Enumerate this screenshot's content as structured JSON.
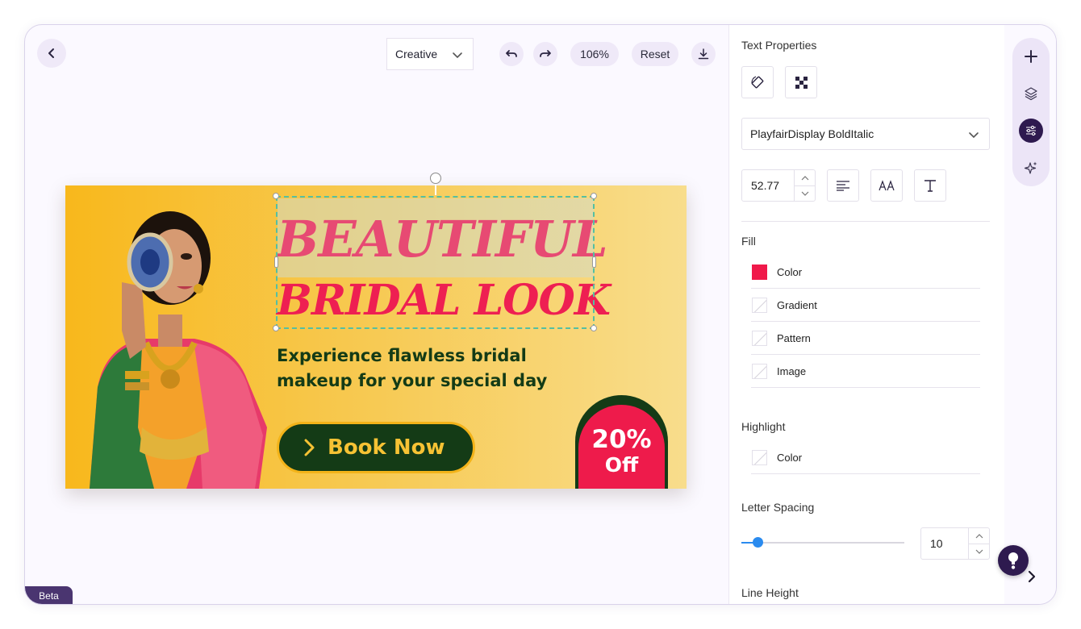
{
  "toolbar": {
    "back_label": "",
    "template_select": "Creative",
    "zoom": "106%",
    "reset_label": "Reset"
  },
  "banner": {
    "headline_line1": "BEAUTIFUL",
    "headline_line2": "BRIDAL LOOK",
    "subline_line1": "Experience flawless bridal",
    "subline_line2": "makeup for your special day",
    "cta_label": "Book Now",
    "offer_percent": "20%",
    "offer_off": "Off",
    "colors": {
      "headline1": "#e74a73",
      "headline2": "#ee1f52",
      "subline": "#143b16",
      "cta_bg": "#143b16",
      "cta_text": "#f6c234",
      "offer_bg": "#ee1b4b",
      "gradient_start": "#f8b81c",
      "gradient_end": "#f8dd8c"
    }
  },
  "beta_label": "Beta",
  "panel": {
    "title": "Text Properties",
    "font_family": "PlayfairDisplay BoldItalic",
    "font_size": "52.77",
    "fill": {
      "title": "Fill",
      "options": [
        {
          "label": "Color",
          "swatch": "#f0194a"
        },
        {
          "label": "Gradient",
          "swatch": ""
        },
        {
          "label": "Pattern",
          "swatch": ""
        },
        {
          "label": "Image",
          "swatch": ""
        }
      ]
    },
    "highlight": {
      "title": "Highlight",
      "color_label": "Color"
    },
    "letter_spacing": {
      "title": "Letter Spacing",
      "value": "10",
      "slider_fraction": 0.1
    },
    "line_height": {
      "title": "Line Height"
    }
  },
  "icons": {
    "back": "chevron-left-icon",
    "undo": "undo-icon",
    "redo": "redo-icon",
    "download": "download-icon",
    "rotate": "rotate-icon",
    "transparency": "checkerboard-icon",
    "align": "align-left-icon",
    "case": "text-case-icon",
    "text_style": "text-style-icon",
    "add": "plus-icon",
    "layers": "layers-icon",
    "adjust": "sliders-icon",
    "magic": "sparkle-icon",
    "help": "help-icon",
    "collapse": "chevron-right-icon"
  }
}
